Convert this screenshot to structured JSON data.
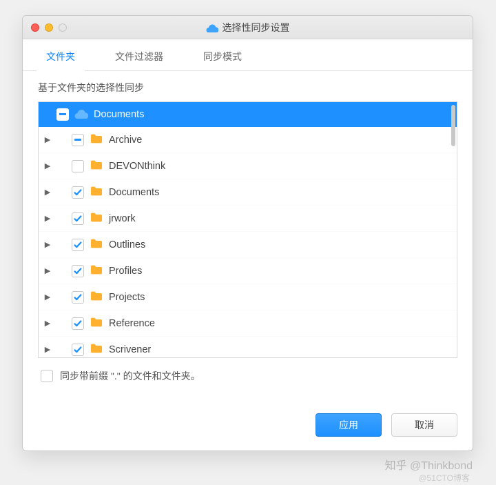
{
  "window": {
    "title": "选择性同步设置"
  },
  "tabs": {
    "items": [
      {
        "label": "文件夹",
        "active": true
      },
      {
        "label": "文件过滤器",
        "active": false
      },
      {
        "label": "同步模式",
        "active": false
      }
    ]
  },
  "section_label": "基于文件夹的选择性同步",
  "tree": {
    "root": {
      "label": "Documents",
      "state": "indeterminate",
      "icon": "cloud"
    },
    "children": [
      {
        "label": "Archive",
        "state": "indeterminate",
        "icon": "folder"
      },
      {
        "label": "DEVONthink",
        "state": "unchecked",
        "icon": "folder"
      },
      {
        "label": "Documents",
        "state": "checked",
        "icon": "folder"
      },
      {
        "label": "jrwork",
        "state": "checked",
        "icon": "folder"
      },
      {
        "label": "Outlines",
        "state": "checked",
        "icon": "folder"
      },
      {
        "label": "Profiles",
        "state": "checked",
        "icon": "folder"
      },
      {
        "label": "Projects",
        "state": "checked",
        "icon": "folder"
      },
      {
        "label": "Reference",
        "state": "checked",
        "icon": "folder"
      },
      {
        "label": "Scrivener",
        "state": "checked",
        "icon": "folder"
      }
    ]
  },
  "footer_checkbox": {
    "label": "同步带前缀 \".\" 的文件和文件夹。",
    "checked": false
  },
  "buttons": {
    "apply": "应用",
    "cancel": "取消"
  },
  "watermark": "知乎 @Thinkbond",
  "watermark2": "@51CTO博客"
}
